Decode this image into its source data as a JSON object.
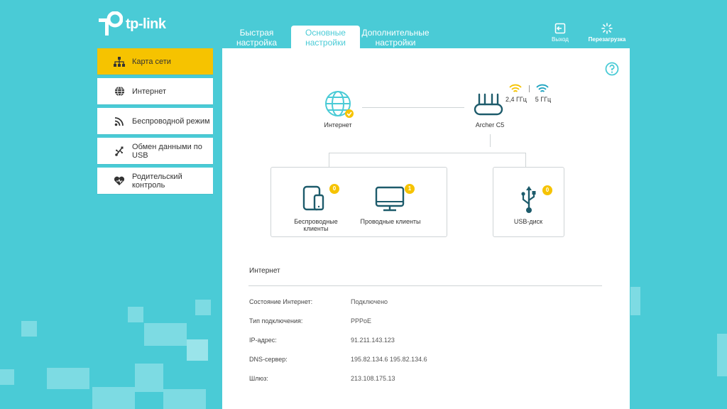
{
  "brand": {
    "name": "tp-link",
    "accent": "#4acbd6",
    "highlight": "#f6c300"
  },
  "tabs": [
    {
      "label_line1": "Быстрая",
      "label_line2": "настройка"
    },
    {
      "label_line1": "Основные",
      "label_line2": "настройки"
    },
    {
      "label_line1": "Дополнительные",
      "label_line2": "настройки"
    }
  ],
  "top_actions": {
    "logout": "Выход",
    "reboot": "Перезагрузка"
  },
  "sidebar": {
    "items": [
      {
        "label": "Карта сети",
        "icon": "network-map-icon"
      },
      {
        "label": "Интернет",
        "icon": "globe-icon"
      },
      {
        "label": "Беспроводной режим",
        "icon": "wireless-icon"
      },
      {
        "label_line1": "Обмен данными по",
        "label_line2": "USB",
        "icon": "usb-icon"
      },
      {
        "label_line1": "Родительский",
        "label_line2": "контроль",
        "icon": "parental-icon"
      }
    ]
  },
  "network_map": {
    "internet": "Интернет",
    "router": "Archer C5",
    "band_24": "2,4 ГГц",
    "band_5": "5 ГГц",
    "wireless_clients_line1": "Беспроводные",
    "wireless_clients_line2": "клиенты",
    "wireless_clients_count": "0",
    "wired_clients": "Проводные клиенты",
    "wired_clients_count": "1",
    "usb_disk": "USB-диск",
    "usb_disk_count": "0"
  },
  "internet_info": {
    "title": "Интернет",
    "rows": [
      {
        "key": "Состояние Интернет:",
        "value": "Подключено"
      },
      {
        "key": "Тип подключения:",
        "value": "PPPoE"
      },
      {
        "key": "IP-адрес:",
        "value": "91.211.143.123"
      },
      {
        "key": "DNS-сервер:",
        "value": "195.82.134.6 195.82.134.6"
      },
      {
        "key": "Шлюз:",
        "value": "213.108.175.13"
      }
    ]
  }
}
